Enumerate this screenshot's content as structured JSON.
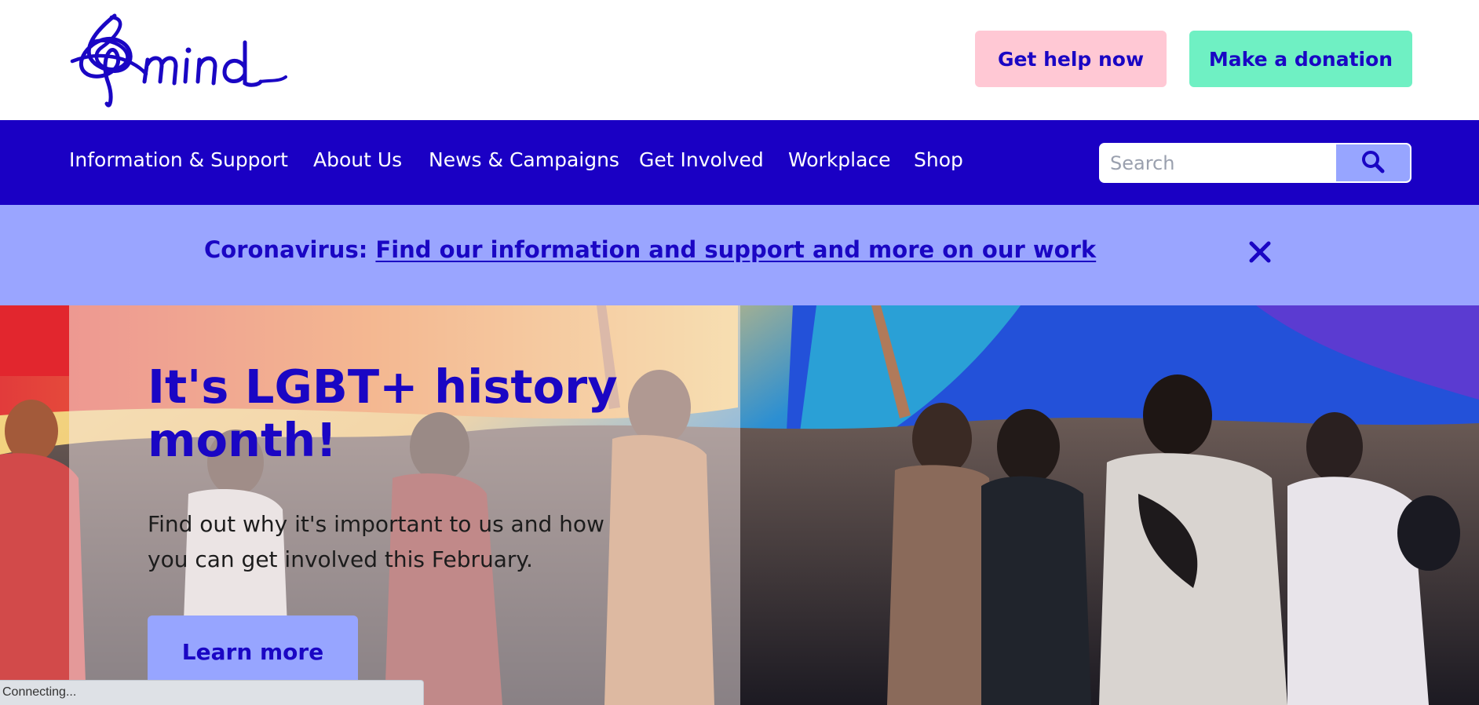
{
  "header": {
    "logo_text": "mind",
    "get_help_label": "Get help now",
    "donate_label": "Make a donation"
  },
  "nav": {
    "items": [
      {
        "label": "Information & Support"
      },
      {
        "label": "About Us"
      },
      {
        "label": "News & Campaigns"
      },
      {
        "label": "Get Involved"
      },
      {
        "label": "Workplace"
      },
      {
        "label": "Shop"
      }
    ],
    "search": {
      "placeholder": "Search",
      "value": ""
    }
  },
  "alert": {
    "prefix": "Coronavirus: ",
    "link_text": "Find our information and support and more on our work"
  },
  "hero": {
    "title": "It's LGBT+ history month!",
    "body": "Find out why it's important to us and how you can get involved this February.",
    "cta_label": "Learn more"
  },
  "status": {
    "text": "Connecting..."
  },
  "colors": {
    "brand_blue": "#1a00c4",
    "periwinkle": "#9aa5ff",
    "pink": "#ffc8d4",
    "mint": "#6ff0c3"
  }
}
